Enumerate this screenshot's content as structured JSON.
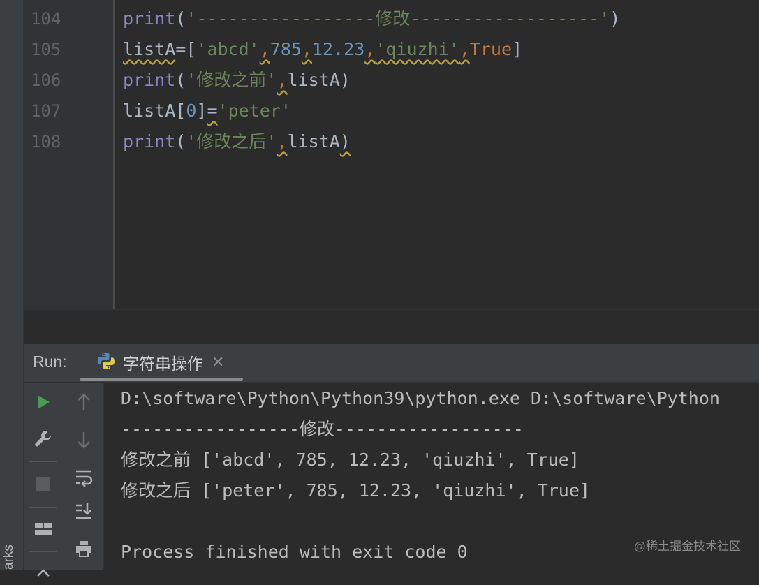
{
  "side_label": "arks",
  "editor": {
    "lines": [
      {
        "number": "104"
      },
      {
        "number": "105"
      },
      {
        "number": "106"
      },
      {
        "number": "107"
      },
      {
        "number": "108"
      }
    ],
    "code": {
      "l104": {
        "fn": "print",
        "open": "(",
        "str": "'-----------------修改------------------'",
        "close": ")"
      },
      "l105": {
        "name": "listA",
        "eq": "=",
        "lb": "[",
        "s1": "'abcd'",
        "c1": ",",
        "n1": "785",
        "c2": ",",
        "n2": "12.23",
        "c3": ",",
        "s2": "'qiuzhi'",
        "c4": ",",
        "k1": "True",
        "rb": "]"
      },
      "l106": {
        "fn": "print",
        "open": "(",
        "str": "'修改之前'",
        "comma": ",",
        "arg": "listA",
        "close": ")"
      },
      "l107": {
        "name": "listA",
        "lb": "[",
        "idx": "0",
        "rb": "]",
        "eq": "=",
        "str": "'peter'"
      },
      "l108": {
        "fn": "print",
        "open": "(",
        "str": "'修改之后'",
        "comma": ",",
        "arg": "listA",
        "close": ")"
      }
    }
  },
  "run_panel": {
    "label": "Run:",
    "tab_title": "字符串操作",
    "tab_close": "✕",
    "console_lines": [
      "D:\\software\\Python\\Python39\\python.exe D:\\software\\Python",
      "-----------------修改------------------",
      "修改之前 ['abcd', 785, 12.23, 'qiuzhi', True]",
      "修改之后 ['peter', 785, 12.23, 'qiuzhi', True]",
      "",
      "Process finished with exit code 0"
    ]
  },
  "watermark": "@稀土掘金技术社区",
  "colors": {
    "editor_bg": "#2b2b2b",
    "function": "#8888c6",
    "string": "#6a8759",
    "number": "#6897bb",
    "keyword": "#cc7832",
    "run_green": "#499c54"
  }
}
